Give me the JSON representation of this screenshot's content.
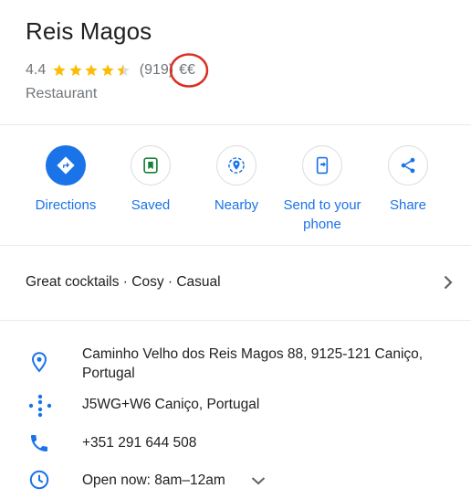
{
  "place": {
    "name": "Reis Magos",
    "rating": "4.4",
    "stars_filled": 4.5,
    "reviews": "(919)",
    "price": "€€",
    "category": "Restaurant"
  },
  "actions": {
    "directions": "Directions",
    "saved": "Saved",
    "nearby": "Nearby",
    "send_line1": "Send to your",
    "send_line2": "phone",
    "share": "Share"
  },
  "tags": "Great cocktails · Cosy · Casual",
  "info": {
    "address_line1": "Caminho Velho dos Reis Magos 88, 9125-121 Caniço,",
    "address_line2": "Portugal",
    "plus_code": "J5WG+W6 Caniço, Portugal",
    "phone": "+351 291 644 508",
    "hours": "Open now:  8am–12am"
  },
  "colors": {
    "accent": "#1a73e8",
    "star": "#fbbc04",
    "annotation_circle": "#d93025",
    "secondary_text": "#70757a"
  },
  "icons": [
    "star-icon",
    "directions-icon",
    "bookmark-icon",
    "nearby-icon",
    "send-to-phone-icon",
    "share-icon",
    "chevron-right-icon",
    "location-pin-icon",
    "plus-code-icon",
    "phone-icon",
    "clock-icon",
    "chevron-down-icon"
  ]
}
